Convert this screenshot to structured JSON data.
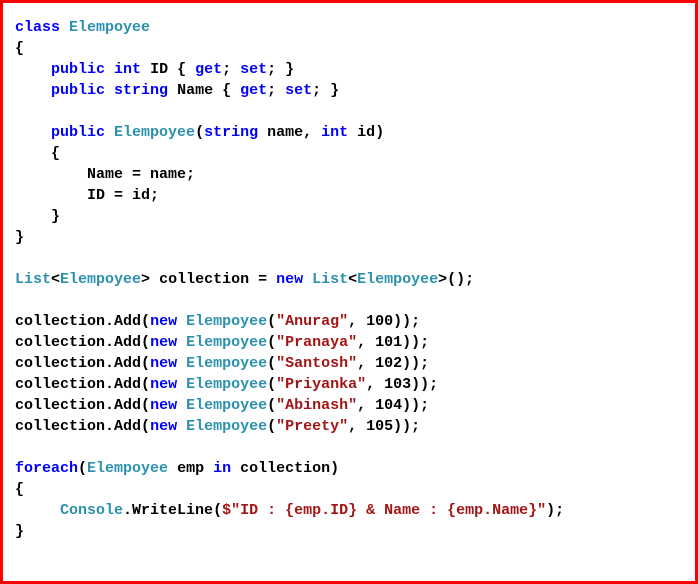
{
  "code": {
    "kw_class": "class",
    "kw_public": "public",
    "kw_int": "int",
    "kw_string": "string",
    "kw_get": "get",
    "kw_set": "set",
    "kw_new": "new",
    "kw_foreach": "foreach",
    "kw_in": "in",
    "type_Elempoyee": "Elempoyee",
    "type_List": "List",
    "type_Console": "Console",
    "prop_ID": "ID",
    "prop_Name": "Name",
    "ctor_params": "name",
    "ctor_param_id": "id",
    "var_collection": "collection",
    "method_Add": "Add",
    "method_WriteLine": "WriteLine",
    "var_emp": "emp",
    "emp1_name": "\"Anurag\"",
    "emp1_id": "100",
    "emp2_name": "\"Pranaya\"",
    "emp2_id": "101",
    "emp3_name": "\"Santosh\"",
    "emp3_id": "102",
    "emp4_name": "\"Priyanka\"",
    "emp4_id": "103",
    "emp5_name": "\"Abinash\"",
    "emp5_id": "104",
    "emp6_name": "\"Preety\"",
    "emp6_id": "105",
    "writeline_str": "$\"ID : {emp.ID} & Name : {emp.Name}\"",
    "assign_name": "Name = name;",
    "assign_id": "ID = id;"
  }
}
